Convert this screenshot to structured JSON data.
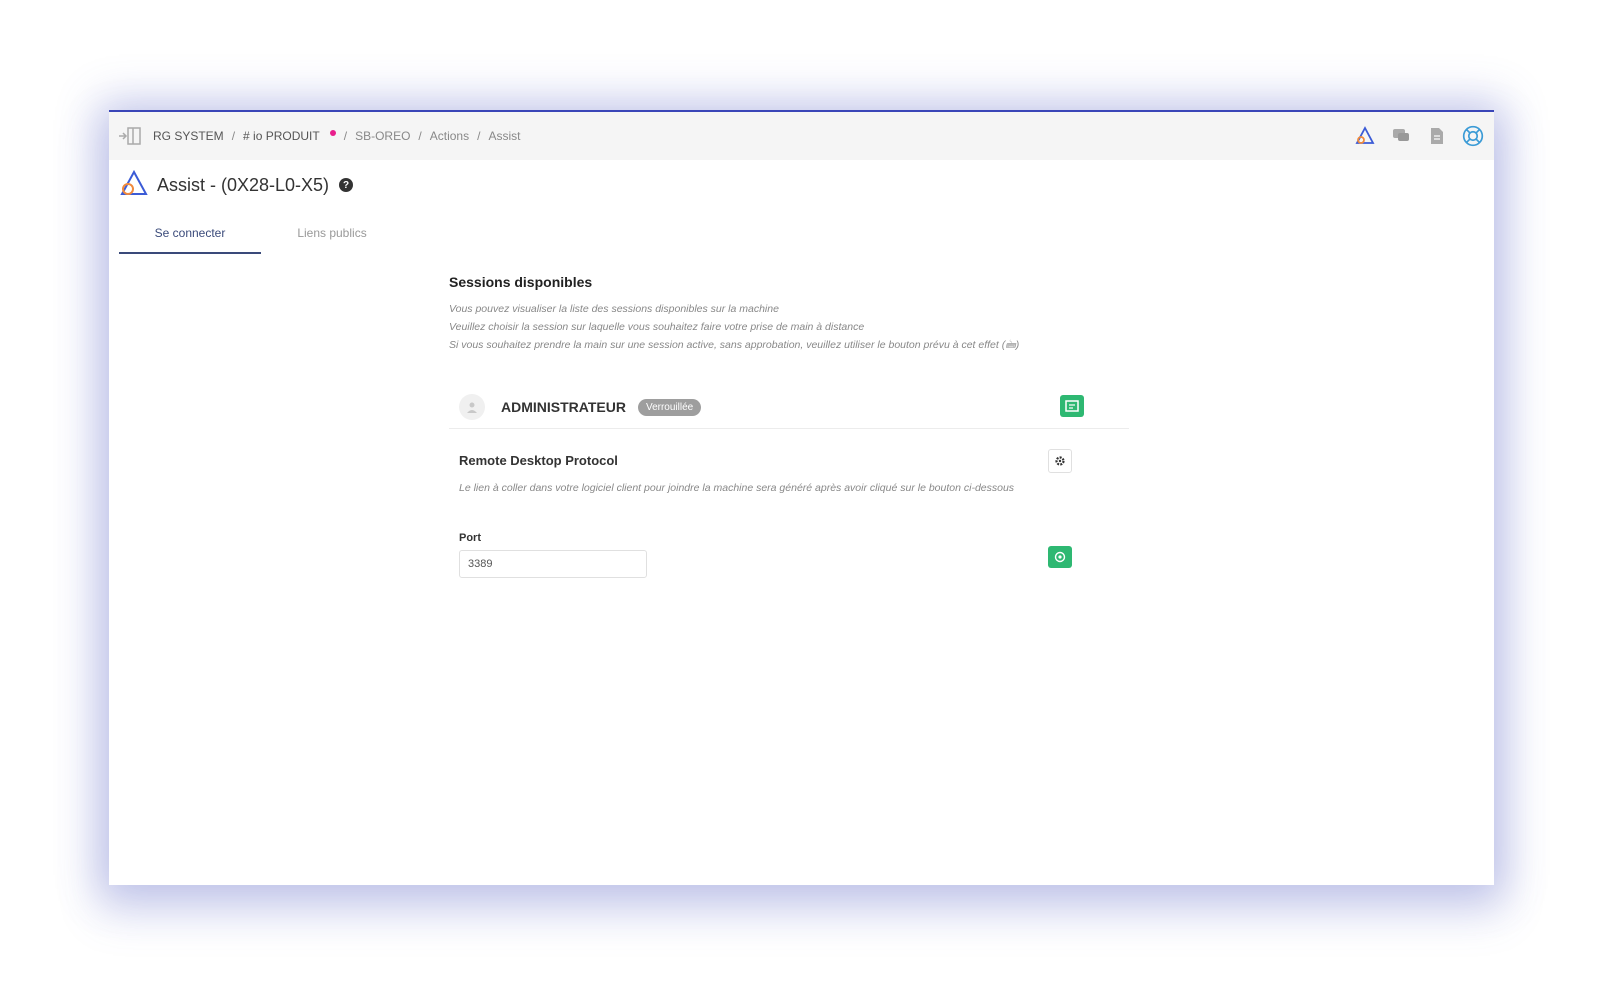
{
  "breadcrumb": {
    "items": [
      "RG SYSTEM",
      "# io PRODUIT",
      "SB-OREO",
      "Actions",
      "Assist"
    ],
    "separator": "/"
  },
  "topbar_icons": [
    "assist-icon",
    "chat-icon",
    "document-icon",
    "lifebuoy-icon"
  ],
  "page": {
    "title": "Assist - (0X28-L0-X5)",
    "help": "?"
  },
  "tabs": [
    {
      "label": "Se connecter",
      "active": true
    },
    {
      "label": "Liens publics",
      "active": false
    }
  ],
  "sessions": {
    "title": "Sessions disponibles",
    "desc_lines": [
      "Vous pouvez visualiser la liste des sessions disponibles sur la machine",
      "Veuillez choisir la session sur laquelle vous souhaitez faire votre prise de main à distance",
      "Si vous souhaitez prendre la main sur une session active, sans approbation, veuillez utiliser le bouton prévu à cet effet (🖮)"
    ],
    "items": [
      {
        "name": "ADMINISTRATEUR",
        "badge": "Verrouillée"
      }
    ]
  },
  "rdp": {
    "title": "Remote Desktop Protocol",
    "desc": "Le lien à coller dans votre logiciel client pour joindre la machine sera généré après avoir cliqué sur le bouton ci-dessous",
    "port_label": "Port",
    "port_value": "3389"
  },
  "colors": {
    "accent": "#3a46b8",
    "green": "#2eb872",
    "pink": "#e91e8c",
    "badge": "#9e9e9e"
  }
}
